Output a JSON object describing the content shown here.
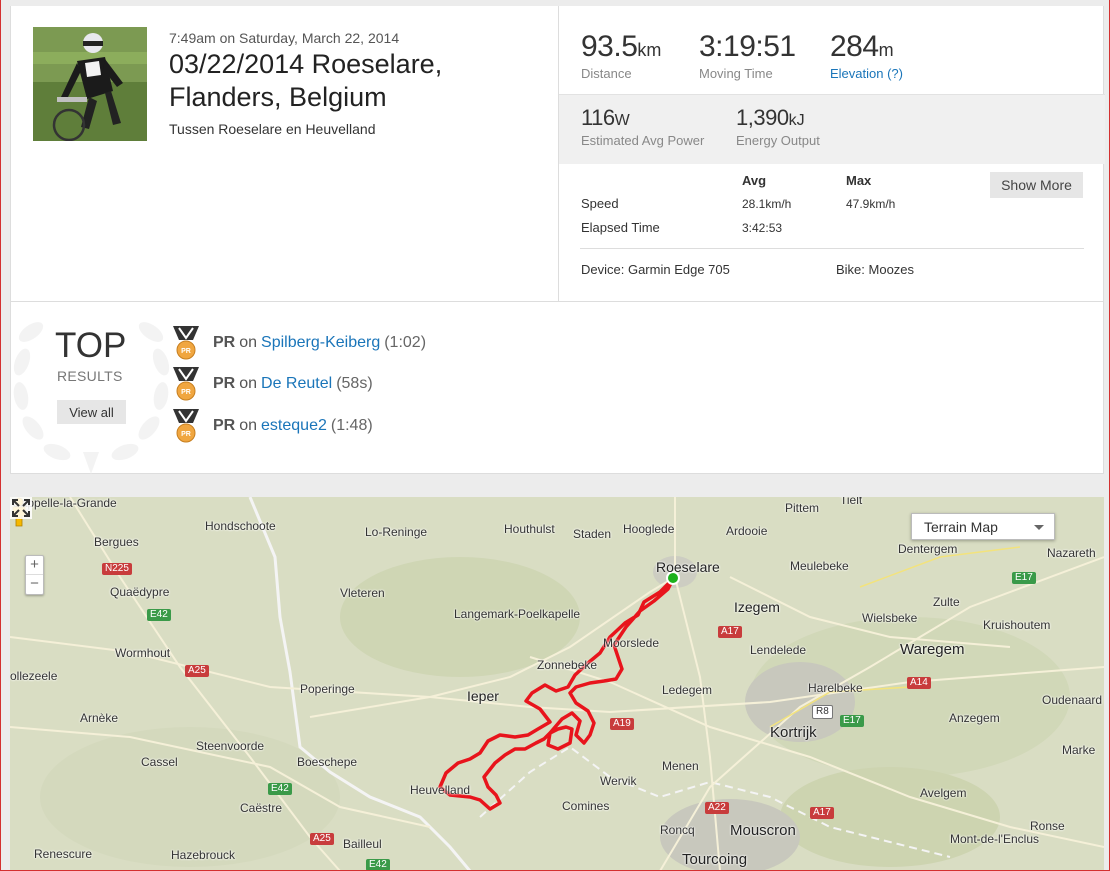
{
  "activity": {
    "time": "7:49am on Saturday, March 22, 2014",
    "title": "03/22/2014 Roeselare, Flanders, Belgium",
    "description": "Tussen Roeselare en Heuvelland"
  },
  "stats": {
    "distance": {
      "value": "93.5",
      "unit": "km",
      "label": "Distance"
    },
    "moving_time": {
      "value": "3:19:51",
      "label": "Moving Time"
    },
    "elevation": {
      "value": "284",
      "unit": "m",
      "label": "Elevation (?)"
    },
    "power": {
      "value": "116",
      "unit": "W",
      "label": "Estimated Avg Power"
    },
    "energy": {
      "value": "1,390",
      "unit": "kJ",
      "label": "Energy Output"
    },
    "table": {
      "avg_header": "Avg",
      "max_header": "Max",
      "rows": [
        {
          "label": "Speed",
          "avg": "28.1km/h",
          "max": "47.9km/h"
        },
        {
          "label": "Elapsed Time",
          "avg": "3:42:53",
          "max": ""
        }
      ]
    },
    "show_more_label": "Show More",
    "device": "Device: Garmin Edge 705",
    "bike": "Bike: Moozes"
  },
  "results": {
    "top_label": "TOP",
    "results_label": "RESULTS",
    "view_all_label": "View all",
    "medal_badge": "PR",
    "items": [
      {
        "prefix": "PR",
        "on": "on",
        "segment": "Spilberg-Keiberg",
        "time": "(1:02)"
      },
      {
        "prefix": "PR",
        "on": "on",
        "segment": "De Reutel",
        "time": "(58s)"
      },
      {
        "prefix": "PR",
        "on": "on",
        "segment": "esteque2",
        "time": "(1:48)"
      }
    ]
  },
  "map": {
    "map_type": "Terrain Map",
    "zoom_in": "+",
    "zoom_out": "−",
    "places": [
      "Cappelle-la-Grande",
      "Hondschoote",
      "Lo-Reninge",
      "Houthulst",
      "Staden",
      "Hooglede",
      "Ardooie",
      "Pittem",
      "Tielt",
      "Bergues",
      "Dentergem",
      "Nazareth",
      "Meulebeke",
      "Roeselare",
      "Quaëdypre",
      "Vleteren",
      "Langemark-Poelkapelle",
      "Izegem",
      "Zulte",
      "Wielsbeke",
      "Kruishoutem",
      "Wormhout",
      "Moorslede",
      "Lendelede",
      "Waregem",
      "Zonnebeke",
      "ollezeele",
      "Poperinge",
      "Ieper",
      "Ledegem",
      "Harelbeke",
      "Oudenaard",
      "Arnèke",
      "Kortrijk",
      "Anzegem",
      "Steenvoorde",
      "Cassel",
      "Boeschepe",
      "Wervik",
      "Menen",
      "Marke",
      "Heuvelland",
      "Caëstre",
      "Comines",
      "Avelgem",
      "Roncq",
      "Mouscron",
      "Ronse",
      "Mont-de-l'Enclus",
      "Renescure",
      "Hazebrouck",
      "Bailleul",
      "Tourcoing"
    ],
    "roads": [
      "N225",
      "E42",
      "A25",
      "E42",
      "A25",
      "A19",
      "A17",
      "R8",
      "E17",
      "A14",
      "E17",
      "A22",
      "A17",
      "E42"
    ]
  },
  "colors": {
    "link": "#1a75b9",
    "route": "#e8141c",
    "start_marker": "#1db11d",
    "map_bg": "#d9ddc3",
    "frame": "#d43030"
  }
}
